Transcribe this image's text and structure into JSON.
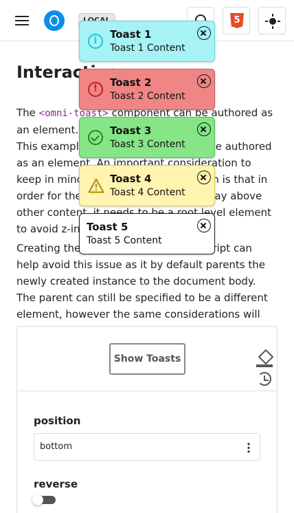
{
  "header": {
    "badge": "LOCAL",
    "menu_icon": "hamburger-icon",
    "logo_icon": "omni-logo-icon",
    "search_icon": "search-icon",
    "html_icon": "html5-icon",
    "theme_icon": "sun-icon",
    "html_glyph": "5"
  },
  "main": {
    "title": "Interactive",
    "p1_start": "The ",
    "p1_code": "<omni-toast>",
    "p1_end": " component can be authored as an element.",
    "p2": "This example shows how a toast can be authored as an element. An important consideration to keep in mind when using this approach is that in order for the element to properly display above other content, it needs to be a root level element to avoid z-index related issues.",
    "p3": "Creating the toast instance via JavaScript can help avoid this issue as it by default parents the newly created instance to the document body. The parent can still be specified to be a different element, however the same considerations will then apply."
  },
  "demo": {
    "show_button": "Show Toasts",
    "paint_icon": "paint-bucket-icon",
    "restore_icon": "restore-icon",
    "position_label": "position",
    "position_value": "bottom",
    "select_menu_icon": "kebab-menu-icon",
    "reverse_label": "reverse",
    "reverse_on": false
  },
  "toasts": [
    {
      "title": "Toast 1",
      "content": "Toast 1 Content",
      "type": "info",
      "icon": "info-icon",
      "color": "#a6f2f5"
    },
    {
      "title": "Toast 2",
      "content": "Toast 2 Content",
      "type": "error",
      "icon": "error-icon",
      "color": "#ef8585"
    },
    {
      "title": "Toast 3",
      "content": "Toast 3 Content",
      "type": "success",
      "icon": "success-icon",
      "color": "#86e586"
    },
    {
      "title": "Toast 4",
      "content": "Toast 4 Content",
      "type": "warning",
      "icon": "warning-icon",
      "color": "#fff4b0"
    },
    {
      "title": "Toast 5",
      "content": "Toast 5 Content",
      "type": "none",
      "color": "#ffffff"
    }
  ]
}
